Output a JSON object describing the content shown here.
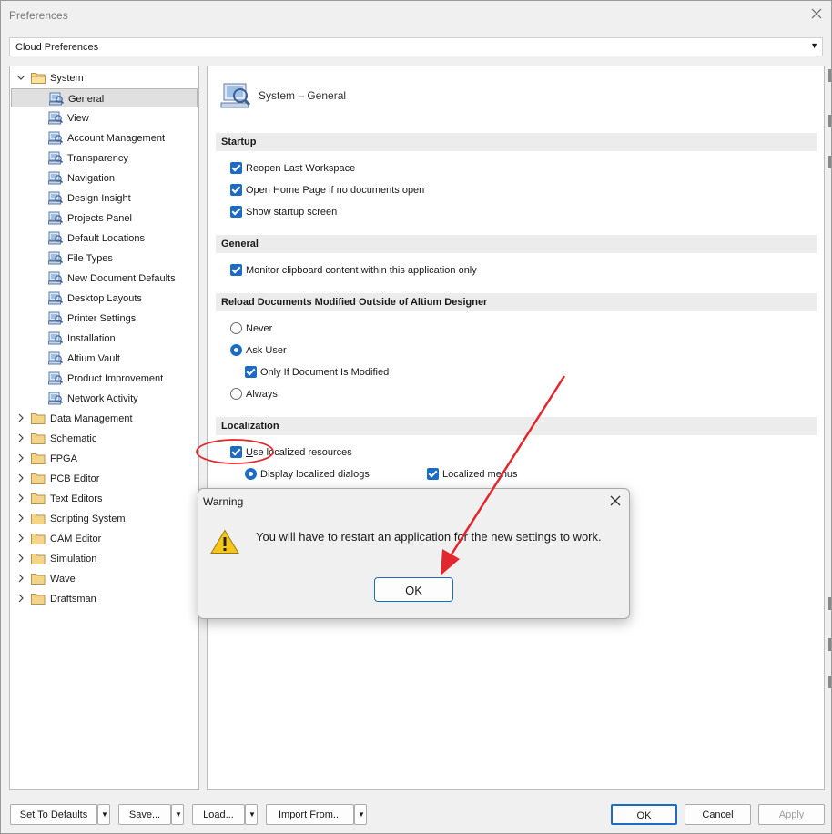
{
  "window": {
    "title": "Preferences"
  },
  "cloud_dropdown": {
    "value": "Cloud Preferences"
  },
  "tree": {
    "root": "System",
    "system_children": [
      "General",
      "View",
      "Account Management",
      "Transparency",
      "Navigation",
      "Design Insight",
      "Projects Panel",
      "Default Locations",
      "File Types",
      "New Document Defaults",
      "Desktop Layouts",
      "Printer Settings",
      "Installation",
      "Altium Vault",
      "Product Improvement",
      "Network Activity"
    ],
    "selected": "General",
    "other_roots": [
      "Data Management",
      "Schematic",
      "FPGA",
      "PCB Editor",
      "Text Editors",
      "Scripting System",
      "CAM Editor",
      "Simulation",
      "Wave",
      "Draftsman"
    ]
  },
  "panel": {
    "title": "System – General",
    "startup": {
      "header": "Startup",
      "options": [
        "Reopen Last Workspace",
        "Open Home Page if no documents open",
        "Show startup screen"
      ]
    },
    "general": {
      "header": "General",
      "options": [
        "Monitor clipboard content within this application only"
      ]
    },
    "reload": {
      "header": "Reload Documents Modified Outside of Altium Designer",
      "never": "Never",
      "ask_user": "Ask User",
      "only_if_modified": "Only If Document Is Modified",
      "always": "Always",
      "selected": "Ask User"
    },
    "localization": {
      "header": "Localization",
      "use_localized_prefix": "U",
      "use_localized_rest": "se localized resources",
      "display_dialogs": "Display localized dialogs",
      "localized_menus": "Localized menus"
    }
  },
  "dialog": {
    "title": "Warning",
    "message": "You will have to restart an application for the new settings to work.",
    "ok": "OK"
  },
  "footer": {
    "set_defaults": "Set To Defaults",
    "save": "Save...",
    "load": "Load...",
    "import": "Import From...",
    "ok": "OK",
    "cancel": "Cancel",
    "apply": "Apply"
  },
  "colors": {
    "accent": "#1c6cc3",
    "annotation": "#e0282e"
  }
}
